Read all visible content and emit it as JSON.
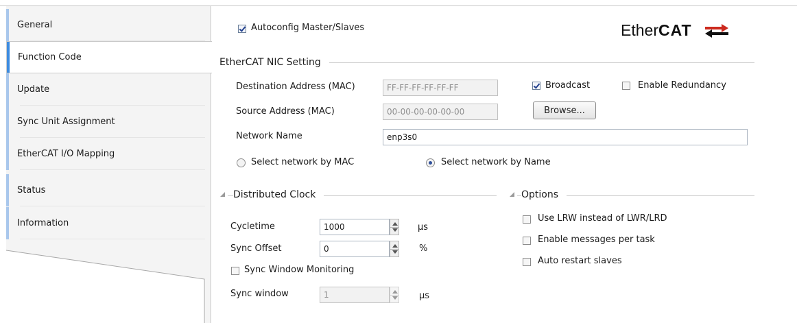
{
  "tabs": [
    {
      "label": "General",
      "active": false
    },
    {
      "label": "Function Code",
      "active": true
    },
    {
      "label": "Update",
      "active": false
    },
    {
      "label": "Sync Unit Assignment",
      "active": false
    },
    {
      "label": "EtherCAT I/O Mapping",
      "active": false
    },
    {
      "label": "Status",
      "active": false
    },
    {
      "label": "Information",
      "active": false
    }
  ],
  "general": {
    "autoconfig_label": "Autoconfig Master/Slaves",
    "autoconfig_checked": true,
    "logo": {
      "ether": "Ether",
      "cat": "CAT",
      "brand_color": "#cc2a1e"
    }
  },
  "nic": {
    "title": "EtherCAT NIC Setting",
    "dest_label": "Destination Address (MAC)",
    "dest_value": "FF-FF-FF-FF-FF-FF",
    "src_label": "Source Address (MAC)",
    "src_value": "00-00-00-00-00-00",
    "broadcast_label": "Broadcast",
    "broadcast_checked": true,
    "redundancy_label": "Enable Redundancy",
    "redundancy_checked": false,
    "browse_label": "Browse...",
    "network_name_label": "Network Name",
    "network_name_value": "enp3s0",
    "radio_mac_label": "Select network by MAC",
    "radio_name_label": "Select network by Name",
    "selected_radio": "name"
  },
  "dc": {
    "title": "Distributed Clock",
    "cycletime_label": "Cycletime",
    "cycletime_value": "1000",
    "cycletime_unit": "µs",
    "sync_offset_label": "Sync Offset",
    "sync_offset_value": "0",
    "sync_offset_unit": "%",
    "sync_window_monitoring_label": "Sync Window Monitoring",
    "sync_window_monitoring_checked": false,
    "sync_window_label": "Sync window",
    "sync_window_value": "1",
    "sync_window_unit": "µs"
  },
  "options": {
    "title": "Options",
    "items": [
      {
        "label": "Use LRW instead of LWR/LRD",
        "checked": false
      },
      {
        "label": "Enable messages per task",
        "checked": false
      },
      {
        "label": "Auto restart slaves",
        "checked": false
      }
    ]
  }
}
